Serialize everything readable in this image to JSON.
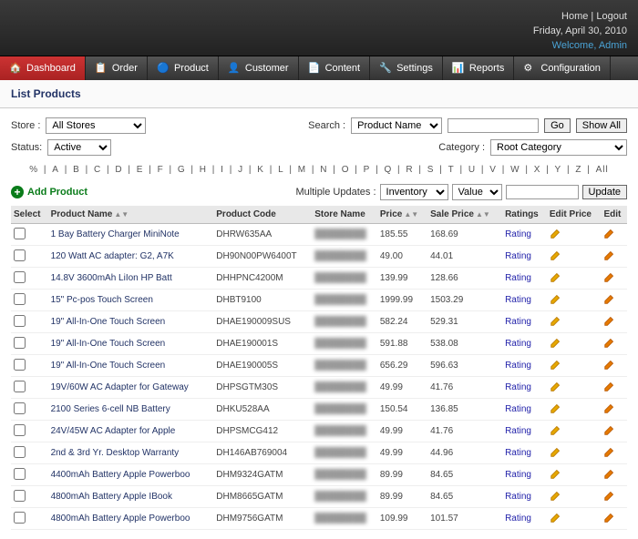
{
  "header": {
    "home": "Home",
    "logout": "Logout",
    "date": "Friday, April 30, 2010",
    "welcome": "Welcome, Admin"
  },
  "nav": [
    {
      "label": "Dashboard"
    },
    {
      "label": "Order"
    },
    {
      "label": "Product"
    },
    {
      "label": "Customer"
    },
    {
      "label": "Content"
    },
    {
      "label": "Settings"
    },
    {
      "label": "Reports"
    },
    {
      "label": "Configuration"
    }
  ],
  "page_title": "List Products",
  "filters": {
    "store_label": "Store :",
    "store_value": "All Stores",
    "search_label": "Search :",
    "search_by": "Product Name",
    "go": "Go",
    "show_all": "Show All",
    "status_label": "Status:",
    "status_value": "Active",
    "category_label": "Category :",
    "category_value": "Root Category"
  },
  "alpha": [
    "%",
    "A",
    "B",
    "C",
    "D",
    "E",
    "F",
    "G",
    "H",
    "I",
    "J",
    "K",
    "L",
    "M",
    "N",
    "O",
    "P",
    "Q",
    "R",
    "S",
    "T",
    "U",
    "V",
    "W",
    "X",
    "Y",
    "Z",
    "All"
  ],
  "toolbar": {
    "add_product": "Add Product",
    "multi_label": "Multiple Updates :",
    "multi_field": "Inventory",
    "multi_op": "Value",
    "update": "Update"
  },
  "columns": {
    "select": "Select",
    "name": "Product Name",
    "code": "Product Code",
    "store": "Store Name",
    "price": "Price",
    "sale": "Sale Price",
    "ratings": "Ratings",
    "edit_price": "Edit Price",
    "edit": "Edit"
  },
  "rating_label": "Rating",
  "rows": [
    {
      "name": "1 Bay Battery Charger MiniNote",
      "code": "DHRW635AA",
      "price": "185.55",
      "sale": "168.69"
    },
    {
      "name": "120 Watt AC adapter: G2, A7K",
      "code": "DH90N00PW6400T",
      "price": "49.00",
      "sale": "44.01"
    },
    {
      "name": "14.8V 3600mAh LiIon HP Batt",
      "code": "DHHPNC4200M",
      "price": "139.99",
      "sale": "128.66"
    },
    {
      "name": "15\" Pc-pos Touch Screen",
      "code": "DHBT9100",
      "price": "1999.99",
      "sale": "1503.29"
    },
    {
      "name": "19\" All-In-One Touch Screen",
      "code": "DHAE190009SUS",
      "price": "582.24",
      "sale": "529.31"
    },
    {
      "name": "19\" All-In-One Touch Screen",
      "code": "DHAE190001S",
      "price": "591.88",
      "sale": "538.08"
    },
    {
      "name": "19\" All-In-One Touch Screen",
      "code": "DHAE190005S",
      "price": "656.29",
      "sale": "596.63"
    },
    {
      "name": "19V/60W AC Adapter for Gateway",
      "code": "DHPSGTM30S",
      "price": "49.99",
      "sale": "41.76"
    },
    {
      "name": "2100 Series 6-cell NB Battery",
      "code": "DHKU528AA",
      "price": "150.54",
      "sale": "136.85"
    },
    {
      "name": "24V/45W AC Adapter for Apple",
      "code": "DHPSMCG412",
      "price": "49.99",
      "sale": "41.76"
    },
    {
      "name": "2nd & 3rd Yr. Desktop Warranty",
      "code": "DH146AB769004",
      "price": "49.99",
      "sale": "44.96"
    },
    {
      "name": "4400mAh Battery Apple Powerboo",
      "code": "DHM9324GATM",
      "price": "89.99",
      "sale": "84.65"
    },
    {
      "name": "4800mAh Battery Apple IBook",
      "code": "DHM8665GATM",
      "price": "89.99",
      "sale": "84.65"
    },
    {
      "name": "4800mAh Battery Apple Powerboo",
      "code": "DHM9756GATM",
      "price": "109.99",
      "sale": "101.57"
    }
  ]
}
